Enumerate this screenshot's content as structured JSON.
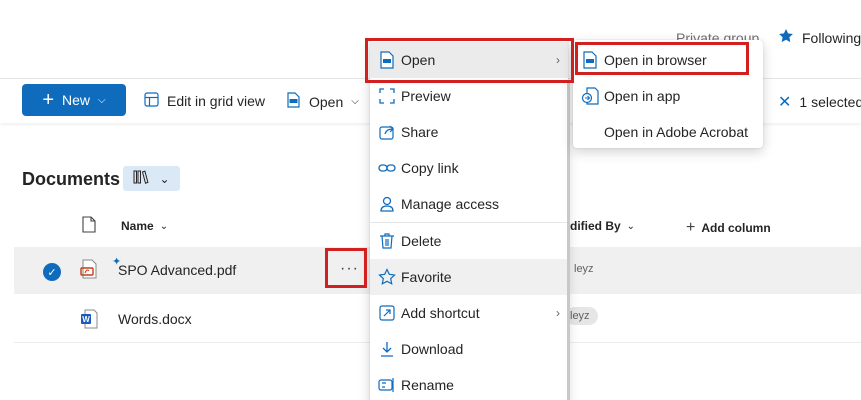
{
  "header": {
    "private_group": "Private group",
    "following": "Following"
  },
  "toolbar": {
    "new_label": "New",
    "edit_grid_label": "Edit in grid view",
    "open_label": "Open",
    "selected_label": "1 selected"
  },
  "library": {
    "title": "Documents",
    "columns": {
      "name": "Name",
      "modified_by": "dified By",
      "add_column": "Add column"
    },
    "files": [
      {
        "name": "SPO Advanced.pdf",
        "modified_by": "leyz",
        "selected": true
      },
      {
        "name": "Words.docx",
        "modified_by": "leyz",
        "selected": false
      }
    ]
  },
  "context_menu": {
    "items": [
      {
        "label": "Open",
        "icon": "pdf-icon"
      },
      {
        "label": "Preview",
        "icon": "preview-icon"
      },
      {
        "label": "Share",
        "icon": "share-icon"
      },
      {
        "label": "Copy link",
        "icon": "link-icon"
      },
      {
        "label": "Manage access",
        "icon": "person-icon"
      },
      {
        "label": "Delete",
        "icon": "trash-icon"
      },
      {
        "label": "Favorite",
        "icon": "star-icon"
      },
      {
        "label": "Add shortcut",
        "icon": "shortcut-icon"
      },
      {
        "label": "Download",
        "icon": "download-icon"
      },
      {
        "label": "Rename",
        "icon": "rename-icon"
      }
    ]
  },
  "open_submenu": {
    "items": [
      {
        "label": "Open in browser",
        "icon": "pdf-icon"
      },
      {
        "label": "Open in app",
        "icon": "app-icon"
      },
      {
        "label": "Open in Adobe Acrobat",
        "icon": ""
      }
    ]
  },
  "colors": {
    "accent": "#0f6cbd",
    "highlight_red": "#d21f1f"
  }
}
